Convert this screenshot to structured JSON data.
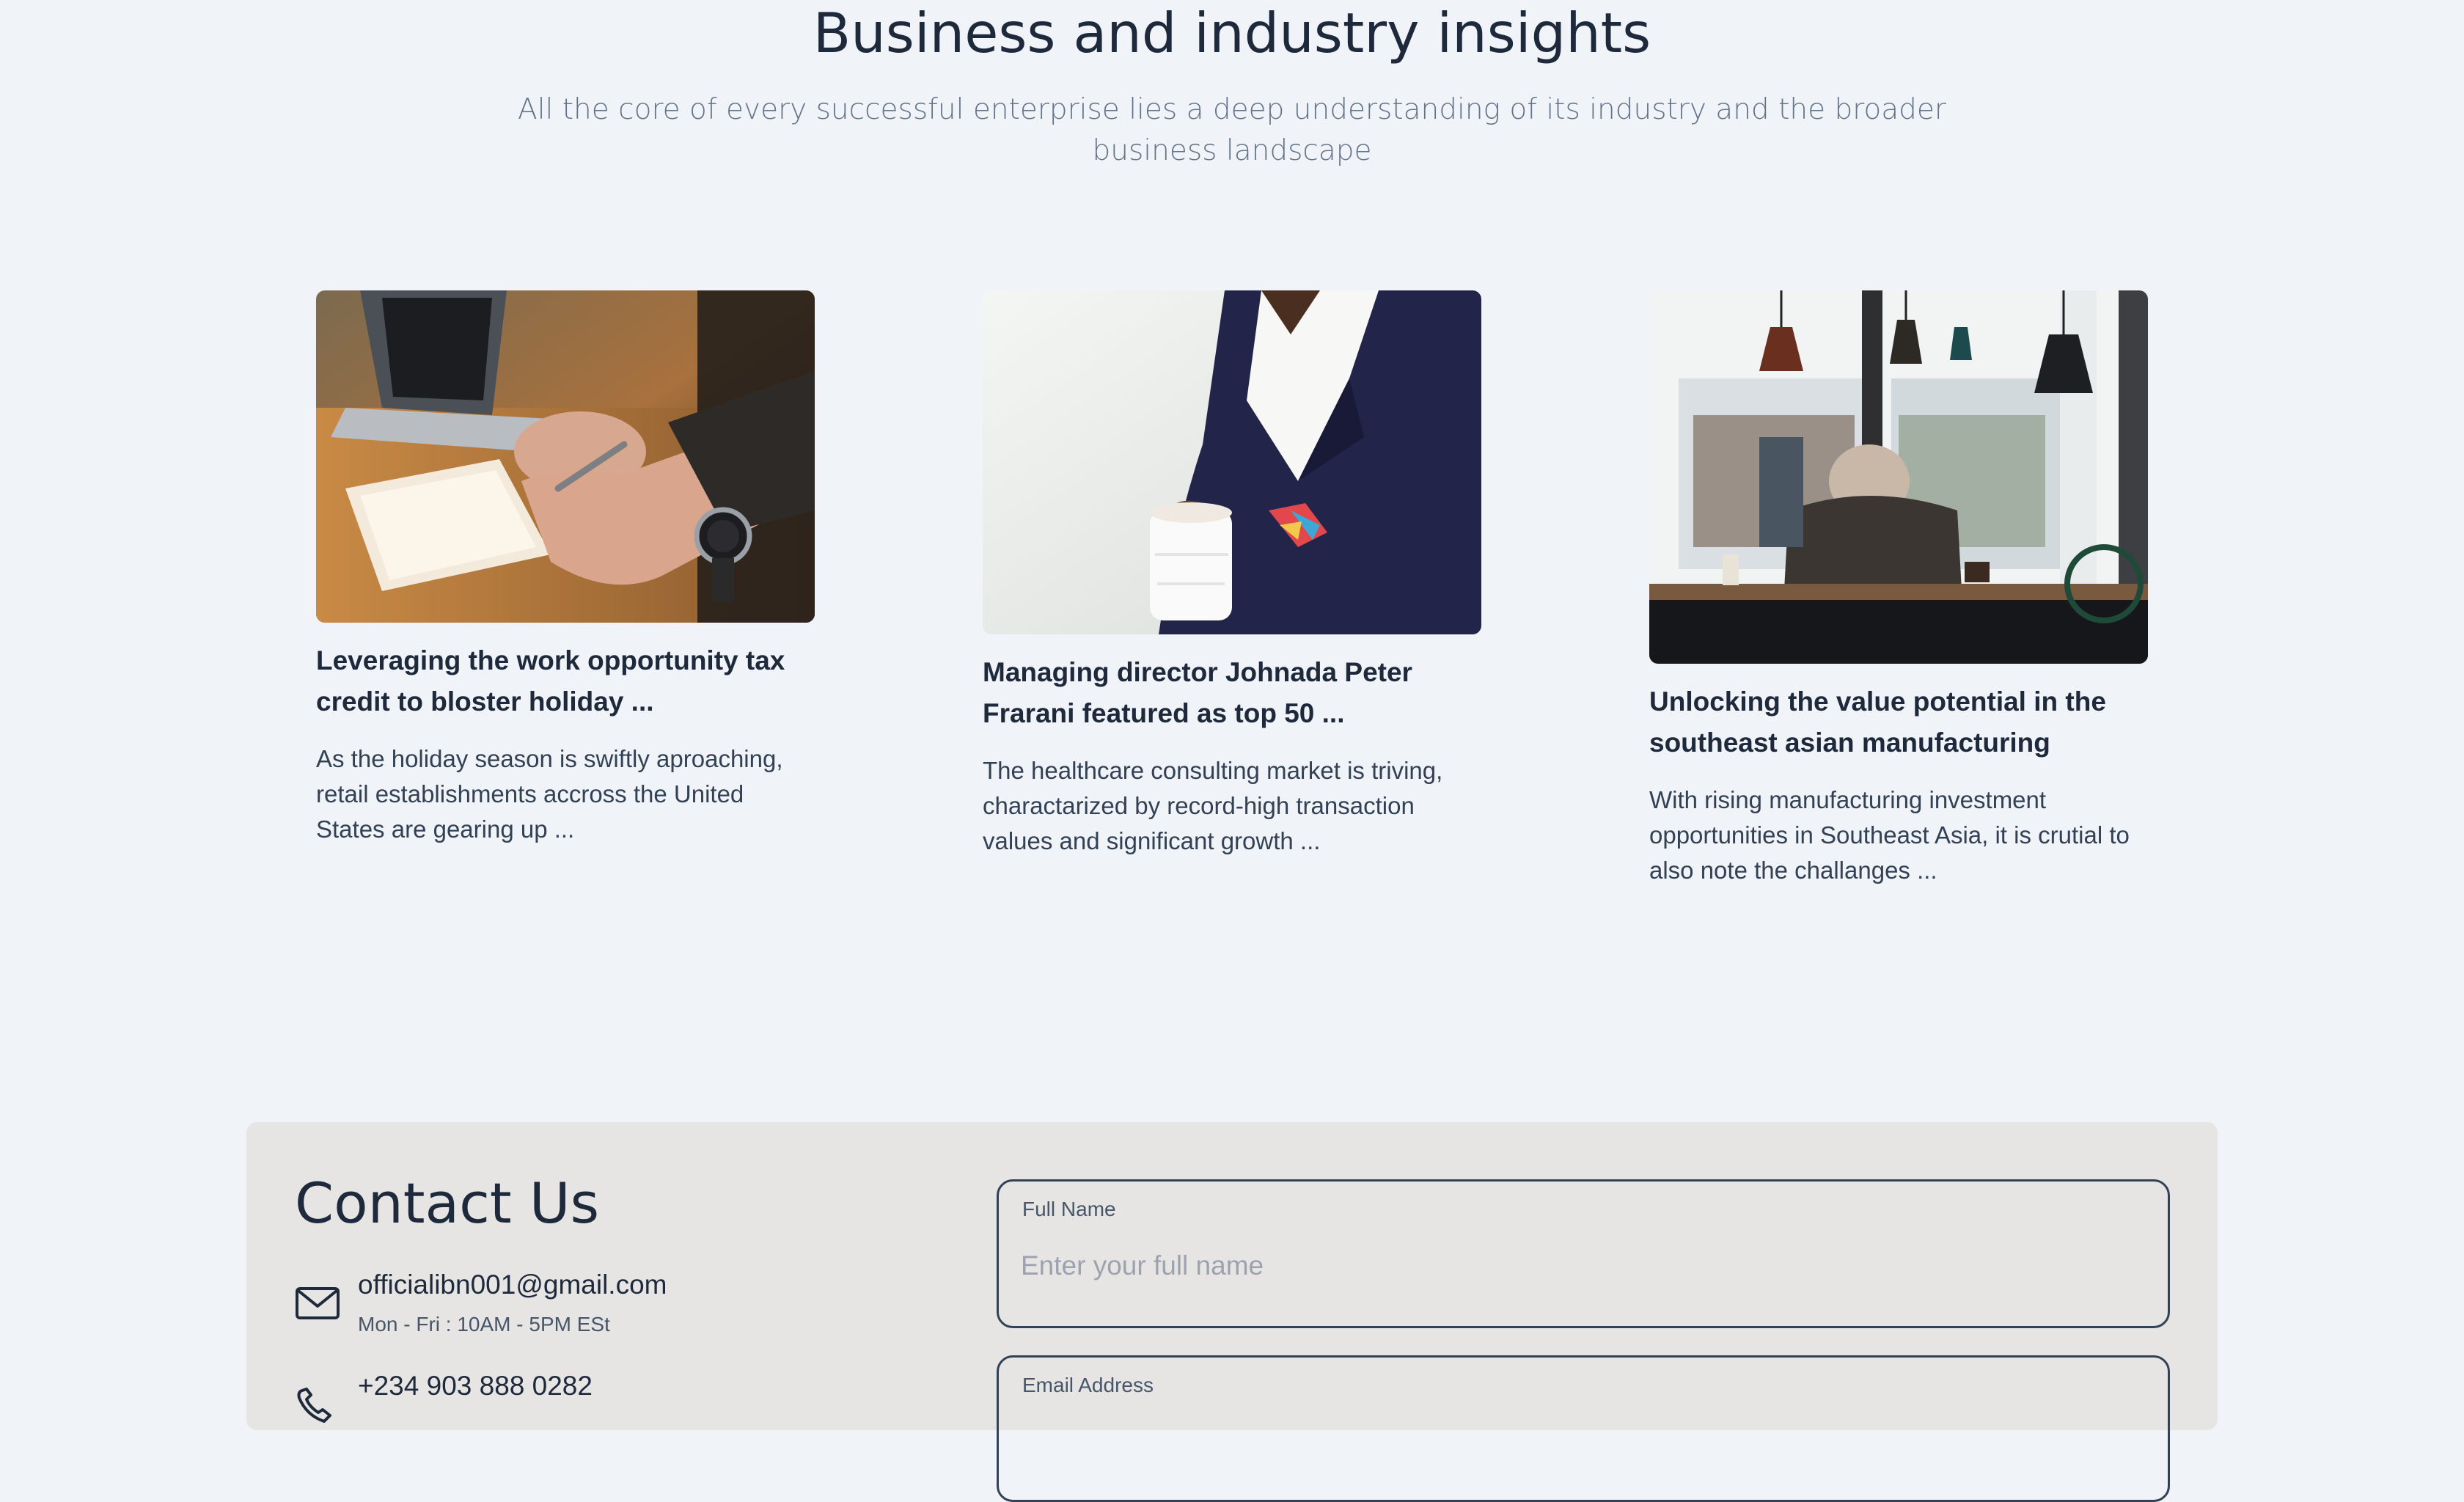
{
  "insights": {
    "title": "Business and industry insights",
    "subtitle": "All the core of every successful enterprise lies a deep understanding of its industry and the broader business landscape",
    "cards": [
      {
        "title": "Leveraging the work opportunity tax credit to bloster holiday ...",
        "excerpt": "As the holiday season is swiftly aproaching, retail establishments accross the United States are gearing up ..."
      },
      {
        "title": "Managing director Johnada Peter Frarani featured as top 50 ...",
        "excerpt": "The healthcare consulting market is triving, charactarized by record-high transaction values and significant growth ..."
      },
      {
        "title": "Unlocking the value potential in the southeast asian manufacturing",
        "excerpt": "With rising manufacturing investment opportunities in Southeast Asia, it is crutial to also note the challanges ..."
      }
    ]
  },
  "contact": {
    "title": "Contact Us",
    "email": "officialibn001@gmail.com",
    "hours": "Mon - Fri : 10AM - 5PM ESt",
    "phone": "+234 903 888 0282",
    "form": {
      "full_name_label": "Full Name",
      "full_name_placeholder": "Enter your full name",
      "email_label": "Email Address"
    }
  },
  "colors": {
    "page_background": "#f0f3f8",
    "contact_background": "#e6e5e3",
    "heading": "#1e293b",
    "muted_text": "#64748b"
  },
  "icons": [
    "mail-icon",
    "phone-icon"
  ]
}
